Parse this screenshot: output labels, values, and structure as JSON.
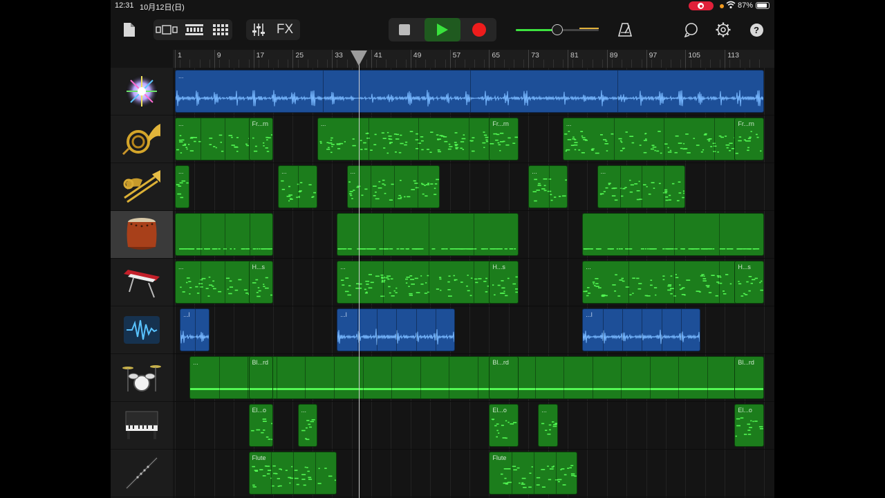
{
  "status_bar": {
    "time": "12:31",
    "date": "10月12日(日)",
    "battery_text": "87%",
    "battery_level": 0.87,
    "recording_indicator_color": "#e0203a"
  },
  "toolbar": {
    "my_songs_icon": "document-icon",
    "view_buttons": [
      "browser-icon",
      "tracks-view-icon",
      "grid-view-icon"
    ],
    "mixer_icon": "sliders-icon",
    "fx_label": "FX",
    "transport": {
      "stop_icon": "stop-icon",
      "play_icon": "play-icon",
      "record_icon": "record-icon"
    },
    "master_volume": 0.5,
    "metronome_icon": "metronome-icon",
    "loop_icon": "loop-icon",
    "settings_icon": "gear-icon",
    "help_label": "?"
  },
  "ruler": {
    "bars": [
      "1",
      "9",
      "17",
      "25",
      "33",
      "41",
      "49",
      "57",
      "65",
      "73",
      "81",
      "89",
      "97",
      "105",
      "113"
    ],
    "add_label": "+",
    "playhead_bar": 38.5
  },
  "colors": {
    "midi_region": "#1c7d1c",
    "audio_region": "#1d4f98",
    "note_color": "#53f853",
    "play_accent": "#39e23c",
    "record": "#ee1c1c"
  },
  "tracks": [
    {
      "name": "Live Loops / FX",
      "icon": "sparkle-burst-icon",
      "type": "audio",
      "regions": [
        {
          "start": 1,
          "end": 121,
          "label": "...",
          "div": 4
        }
      ]
    },
    {
      "name": "French Horn",
      "icon": "french-horn-icon",
      "type": "midi",
      "regions": [
        {
          "start": 1,
          "end": 21,
          "label": "...",
          "div": 4
        },
        {
          "start": 16,
          "end": 21,
          "label": "Fr...rn",
          "div": 1
        },
        {
          "start": 30,
          "end": 71,
          "label": "...",
          "div": 4
        },
        {
          "start": 65,
          "end": 71,
          "label": "Fr...rn",
          "div": 1
        },
        {
          "start": 80,
          "end": 121,
          "label": "...",
          "div": 4
        },
        {
          "start": 115,
          "end": 121,
          "label": "Fr...rn",
          "div": 1
        }
      ]
    },
    {
      "name": "Brass",
      "icon": "trombone-icon",
      "type": "midi",
      "regions": [
        {
          "start": 1,
          "end": 4,
          "label": "...",
          "div": 1
        },
        {
          "start": 22,
          "end": 30,
          "label": "...",
          "div": 2
        },
        {
          "start": 36,
          "end": 55,
          "label": "...",
          "div": 4
        },
        {
          "start": 73,
          "end": 81,
          "label": "...",
          "div": 2
        },
        {
          "start": 87,
          "end": 105,
          "label": "...",
          "div": 4
        }
      ]
    },
    {
      "name": "Taiko Drum",
      "icon": "taiko-drum-icon",
      "type": "midi",
      "regions": [
        {
          "start": 1,
          "end": 21,
          "label": "",
          "div": 4
        },
        {
          "start": 34,
          "end": 71,
          "label": "",
          "div": 4
        },
        {
          "start": 84,
          "end": 121,
          "label": "",
          "div": 4
        }
      ]
    },
    {
      "name": "Synth Keys",
      "icon": "synth-keyboard-icon",
      "type": "midi",
      "regions": [
        {
          "start": 1,
          "end": 21,
          "label": "...",
          "div": 4
        },
        {
          "start": 16,
          "end": 21,
          "label": "H...s",
          "div": 1
        },
        {
          "start": 34,
          "end": 71,
          "label": "...",
          "div": 4
        },
        {
          "start": 65,
          "end": 71,
          "label": "H...s",
          "div": 1
        },
        {
          "start": 84,
          "end": 121,
          "label": "...",
          "div": 4
        },
        {
          "start": 115,
          "end": 121,
          "label": "H...s",
          "div": 1
        }
      ]
    },
    {
      "name": "Audio Recorder",
      "icon": "waveform-icon",
      "type": "audio",
      "regions": [
        {
          "start": 2,
          "end": 8,
          "label": "...l",
          "div": 2
        },
        {
          "start": 34,
          "end": 58,
          "label": "...l",
          "div": 6
        },
        {
          "start": 84,
          "end": 108,
          "label": "...l",
          "div": 6
        }
      ]
    },
    {
      "name": "Drums",
      "icon": "drum-kit-icon",
      "type": "midi",
      "regions": [
        {
          "start": 4,
          "end": 121,
          "label": "...",
          "div": 20
        },
        {
          "start": 16,
          "end": 21,
          "label": "Bl...rd",
          "div": 1
        },
        {
          "start": 65,
          "end": 71,
          "label": "Bl...rd",
          "div": 1
        },
        {
          "start": 115,
          "end": 121,
          "label": "Bl...rd",
          "div": 1
        }
      ]
    },
    {
      "name": "Electric Piano",
      "icon": "piano-icon",
      "type": "midi",
      "regions": [
        {
          "start": 16,
          "end": 21,
          "label": "El...o",
          "div": 1
        },
        {
          "start": 26,
          "end": 30,
          "label": "...",
          "div": 1
        },
        {
          "start": 65,
          "end": 71,
          "label": "El...o",
          "div": 1
        },
        {
          "start": 75,
          "end": 79,
          "label": "...",
          "div": 1
        },
        {
          "start": 115,
          "end": 121,
          "label": "El...o",
          "div": 1
        }
      ]
    },
    {
      "name": "Flute",
      "icon": "flute-icon",
      "type": "midi",
      "regions": [
        {
          "start": 16,
          "end": 34,
          "label": "Flute",
          "div": 4
        },
        {
          "start": 65,
          "end": 83,
          "label": "Flute",
          "div": 4
        }
      ]
    }
  ]
}
